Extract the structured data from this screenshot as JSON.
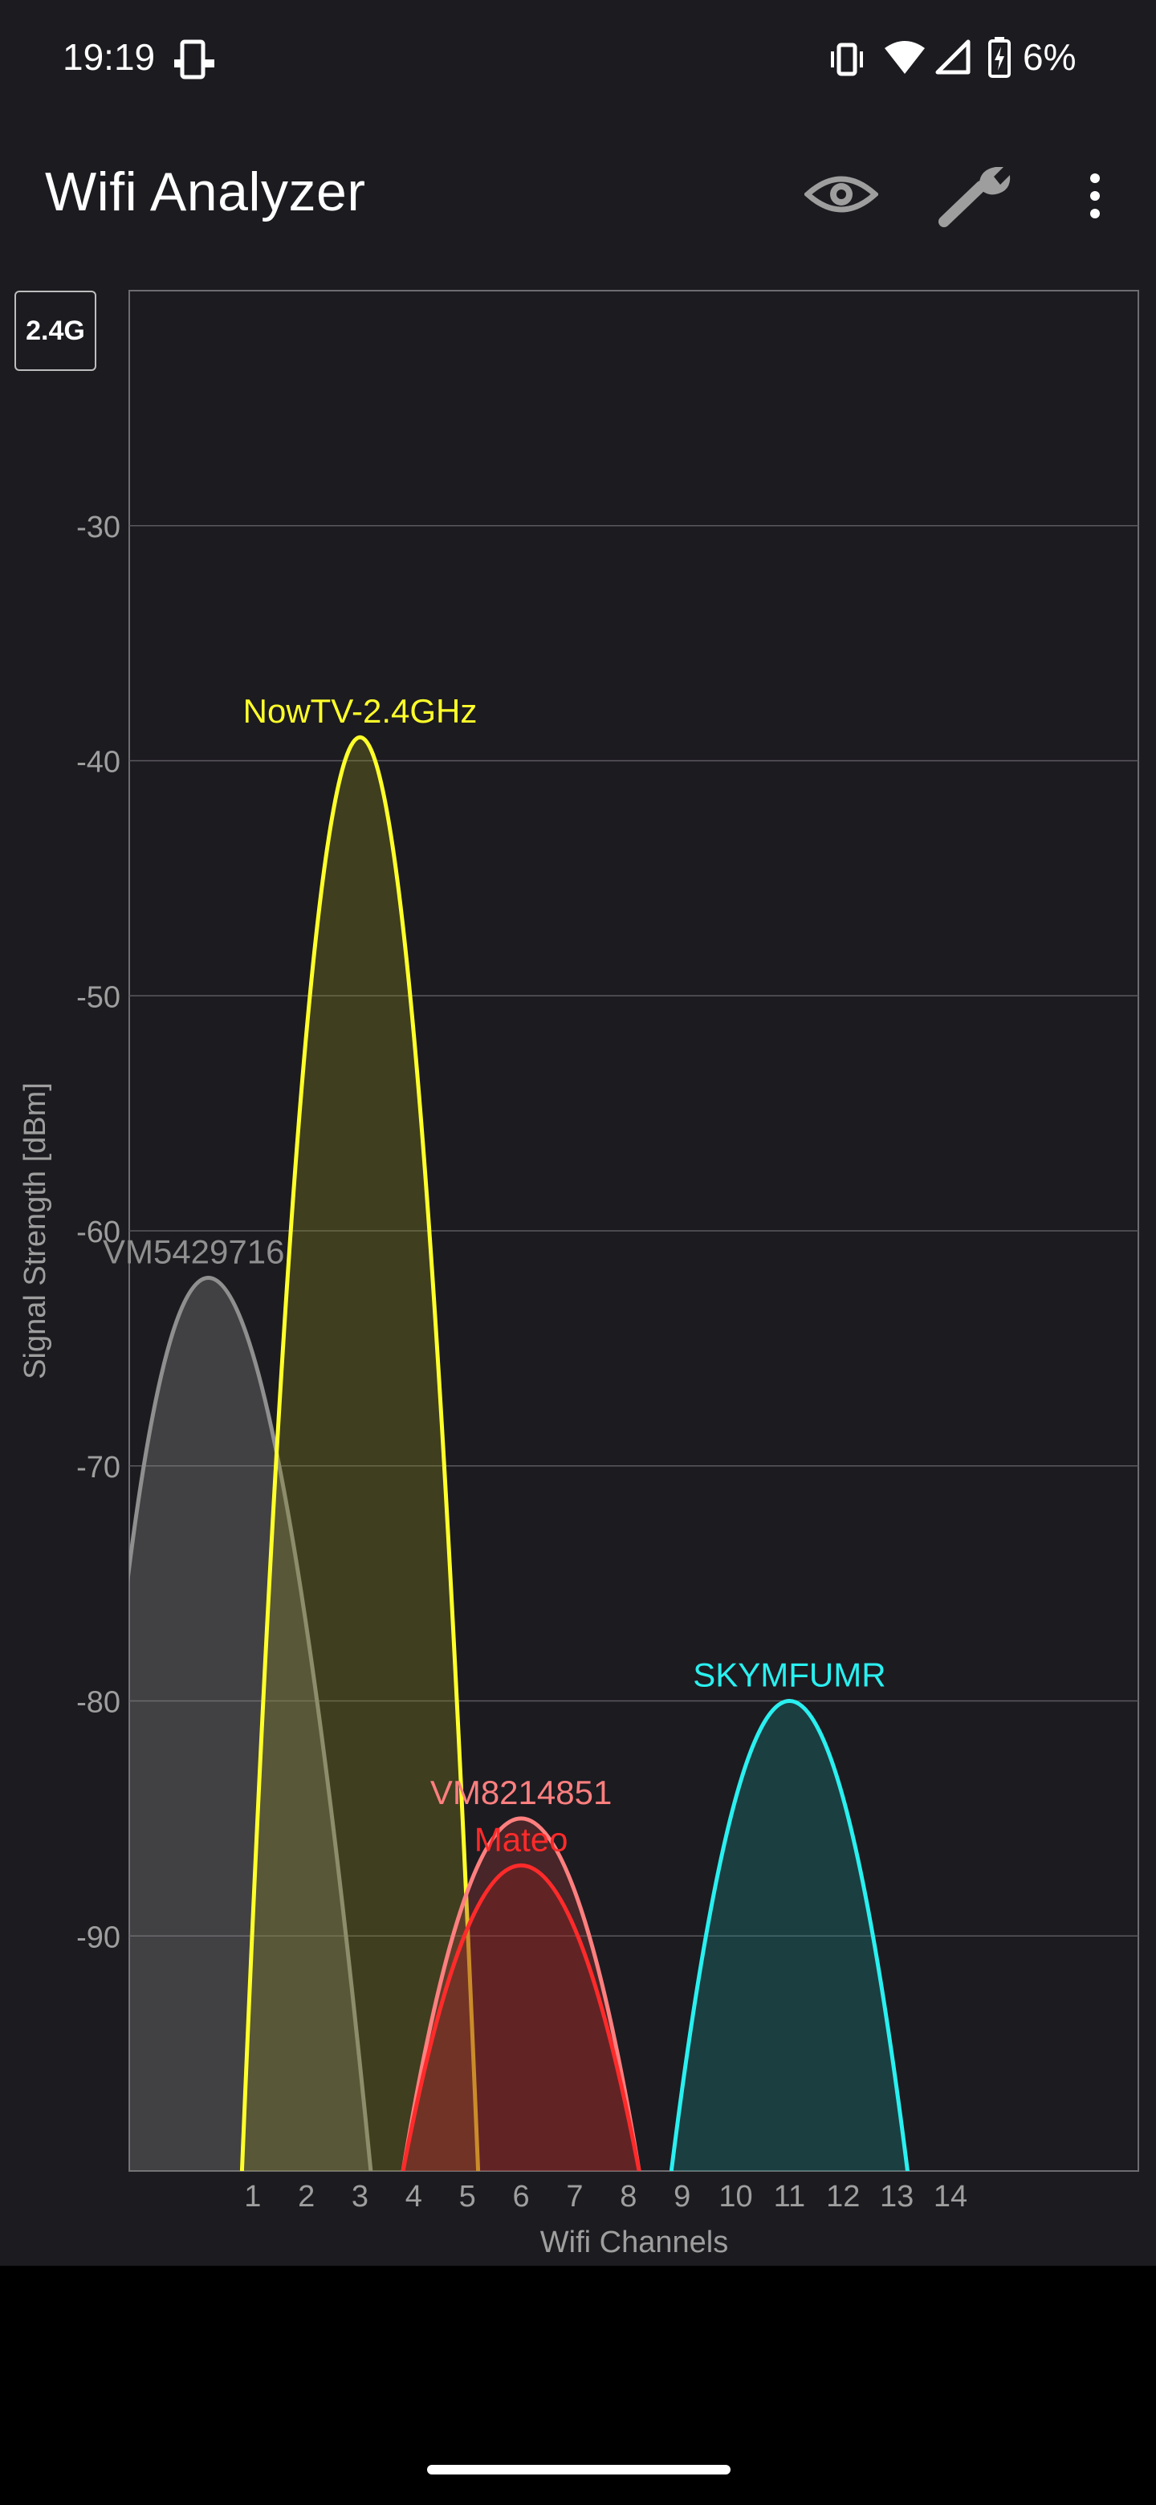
{
  "status_bar": {
    "time": "19:19",
    "battery_percent": "6%",
    "icons": [
      "phone-cast-icon",
      "vibrate-icon",
      "wifi-icon",
      "cellular-signal-icon",
      "battery-charging-icon"
    ]
  },
  "app_bar": {
    "title": "Wifi Analyzer",
    "actions": [
      "eye-icon",
      "wrench-icon",
      "more-vert-icon"
    ]
  },
  "band_button": {
    "label": "2.4G"
  },
  "colors": {
    "background": "#1c1b20",
    "grid": "#5a5a5e",
    "axis_text": "#9e9e9e"
  },
  "chart_data": {
    "type": "area",
    "xlabel": "Wifi Channels",
    "ylabel": "Signal Strength [dBm]",
    "x_ticks": [
      "1",
      "2",
      "3",
      "4",
      "5",
      "6",
      "7",
      "8",
      "9",
      "10",
      "11",
      "12",
      "13",
      "14"
    ],
    "y_ticks": [
      "-30",
      "-40",
      "-50",
      "-60",
      "-70",
      "-80",
      "-90"
    ],
    "xlim": [
      -1.3,
      17.5
    ],
    "ylim": [
      -100,
      -20
    ],
    "grid": true,
    "series": [
      {
        "name": "VM5429716",
        "channel": 1,
        "center": -0.1,
        "left": -2.3,
        "right": 3.2,
        "peak_dbm": -62,
        "color": "#8f8f8f",
        "fill": "#8f8f8f"
      },
      {
        "name": "NowTV-2.4GHz",
        "channel": 3,
        "center": 3.0,
        "left": 0.8,
        "right": 5.2,
        "peak_dbm": -39,
        "color": "#ffff2a",
        "fill": "#8a8a20"
      },
      {
        "name": "VM8214851",
        "channel": 6,
        "center": 6.0,
        "left": 3.8,
        "right": 8.2,
        "peak_dbm": -85,
        "color": "#ff7f7f",
        "fill": "#a33a3a"
      },
      {
        "name": "Mateo",
        "channel": 6,
        "center": 6.0,
        "left": 3.8,
        "right": 8.2,
        "peak_dbm": -87,
        "color": "#ff2a2a",
        "fill": "#9a1f1f"
      },
      {
        "name": "SKYMFUMR",
        "channel": 11,
        "center": 11.0,
        "left": 8.8,
        "right": 13.2,
        "peak_dbm": -80,
        "color": "#2af0f0",
        "fill": "#1a8a8a"
      }
    ]
  }
}
